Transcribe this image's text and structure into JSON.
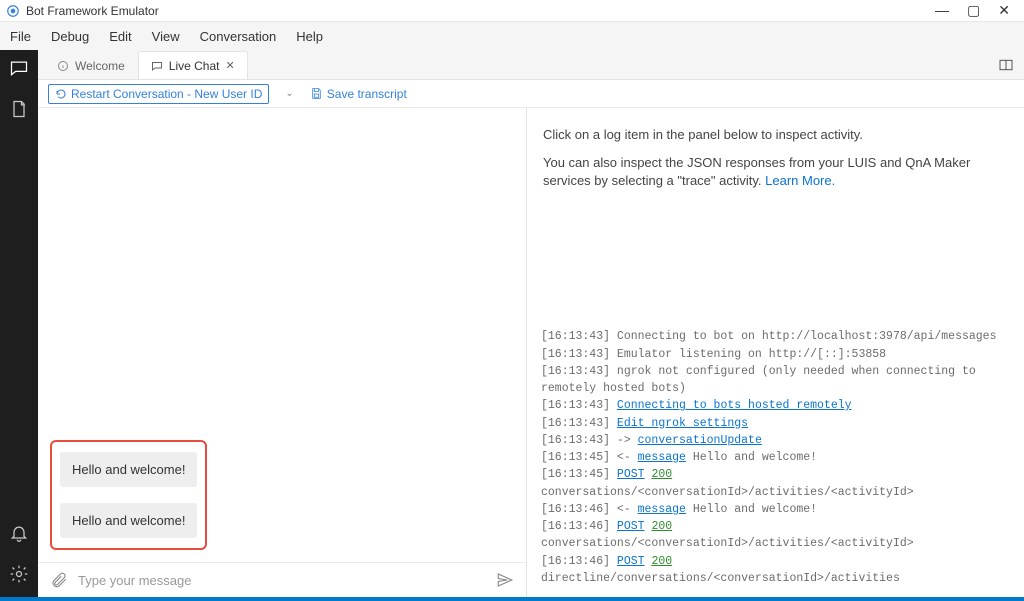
{
  "titlebar": {
    "title": "Bot Framework Emulator"
  },
  "menubar": {
    "items": [
      "File",
      "Debug",
      "Edit",
      "View",
      "Conversation",
      "Help"
    ]
  },
  "tabs": {
    "welcome": {
      "label": "Welcome"
    },
    "livechat": {
      "label": "Live Chat"
    }
  },
  "toolbar": {
    "restart_label": "Restart Conversation - New User ID",
    "save_label": "Save transcript"
  },
  "chat": {
    "messages": [
      "Hello and welcome!",
      "Hello and welcome!"
    ],
    "placeholder": "Type your message"
  },
  "inspector": {
    "line1": "Click on a log item in the panel below to inspect activity.",
    "line2_a": "You can also inspect the JSON responses from your LUIS and QnA Maker services by selecting a \"trace\" activity. ",
    "learn_more": "Learn More."
  },
  "log": [
    {
      "time": "16:13:43",
      "parts": [
        {
          "t": "text",
          "v": "Connecting to bot on http://localhost:3978/api/messages"
        }
      ]
    },
    {
      "time": "16:13:43",
      "parts": [
        {
          "t": "text",
          "v": "Emulator listening on http://[::]:53858"
        }
      ]
    },
    {
      "time": "16:13:43",
      "parts": [
        {
          "t": "text",
          "v": "ngrok not configured (only needed when connecting to remotely hosted bots)"
        }
      ]
    },
    {
      "time": "16:13:43",
      "parts": [
        {
          "t": "link",
          "v": "Connecting to bots hosted remotely"
        }
      ]
    },
    {
      "time": "16:13:43",
      "parts": [
        {
          "t": "link",
          "v": "Edit ngrok settings"
        }
      ]
    },
    {
      "time": "16:13:43",
      "parts": [
        {
          "t": "text",
          "v": "-> "
        },
        {
          "t": "link",
          "v": "conversationUpdate"
        }
      ]
    },
    {
      "time": "16:13:45",
      "parts": [
        {
          "t": "text",
          "v": "<- "
        },
        {
          "t": "link",
          "v": "message"
        },
        {
          "t": "text",
          "v": " Hello and welcome!"
        }
      ]
    },
    {
      "time": "16:13:45",
      "parts": [
        {
          "t": "method",
          "v": "POST"
        },
        {
          "t": "text",
          "v": " "
        },
        {
          "t": "code",
          "v": "200"
        },
        {
          "t": "text",
          "v": " conversations/<conversationId>/activities/<activityId>"
        }
      ]
    },
    {
      "time": "16:13:46",
      "parts": [
        {
          "t": "text",
          "v": "<- "
        },
        {
          "t": "link",
          "v": "message"
        },
        {
          "t": "text",
          "v": " Hello and welcome!"
        }
      ]
    },
    {
      "time": "16:13:46",
      "parts": [
        {
          "t": "method",
          "v": "POST"
        },
        {
          "t": "text",
          "v": " "
        },
        {
          "t": "code",
          "v": "200"
        },
        {
          "t": "text",
          "v": " conversations/<conversationId>/activities/<activityId>"
        }
      ]
    },
    {
      "time": "16:13:46",
      "parts": [
        {
          "t": "method",
          "v": "POST"
        },
        {
          "t": "text",
          "v": " "
        },
        {
          "t": "code",
          "v": "200"
        },
        {
          "t": "text",
          "v": " directline/conversations/<conversationId>/activities"
        }
      ]
    }
  ]
}
